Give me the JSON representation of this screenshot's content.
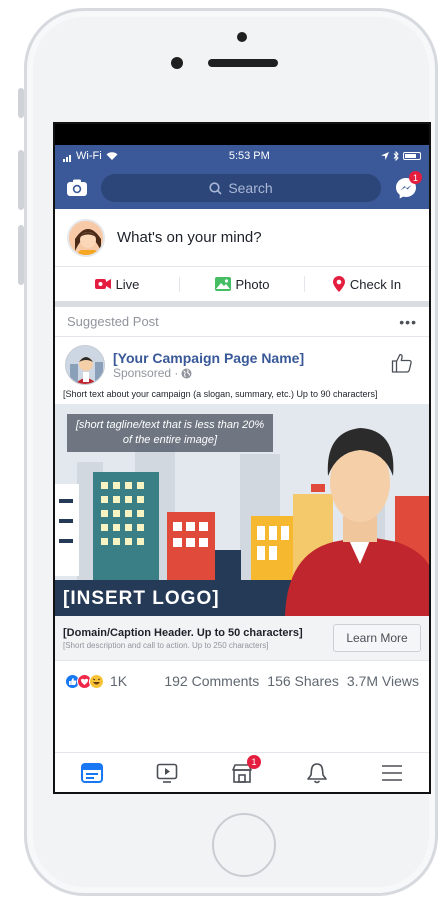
{
  "status_bar": {
    "carrier": "Wi-Fi",
    "time": "5:53 PM"
  },
  "header": {
    "search_placeholder": "Search",
    "messenger_badge": "1"
  },
  "composer": {
    "prompt": "What's on your mind?"
  },
  "composer_actions": [
    {
      "label": "Live",
      "icon": "live-video-icon"
    },
    {
      "label": "Photo",
      "icon": "photo-icon"
    },
    {
      "label": "Check In",
      "icon": "location-pin-icon"
    }
  ],
  "post": {
    "section_label": "Suggested Post",
    "more_label": "•••",
    "author": "[Your Campaign Page Name]",
    "sponsored": "Sponsored · ",
    "text": "[Short text about your campaign (a slogan, summary, etc.) Up to 90 characters]",
    "image": {
      "tagline": "[short tagline/text that is less than 20% of the entire image]",
      "logo_text": "[INSERT LOGO]"
    },
    "link": {
      "header": "[Domain/Caption Header. Up to 50 characters]",
      "description": "[Short description and call to action. Up to 250 characters]",
      "cta": "Learn More"
    },
    "stats": {
      "reactions_count": "1K",
      "comments": "192 Comments",
      "shares": "156 Shares",
      "views": "3.7M Views"
    }
  },
  "tab_bar": {
    "items": [
      "news-feed-icon",
      "watch-icon",
      "marketplace-icon",
      "notifications-icon",
      "menu-icon"
    ],
    "marketplace_badge": "1"
  },
  "colors": {
    "brand": "#3b5998",
    "badge": "#e41e3f",
    "link_blue": "#385898"
  }
}
